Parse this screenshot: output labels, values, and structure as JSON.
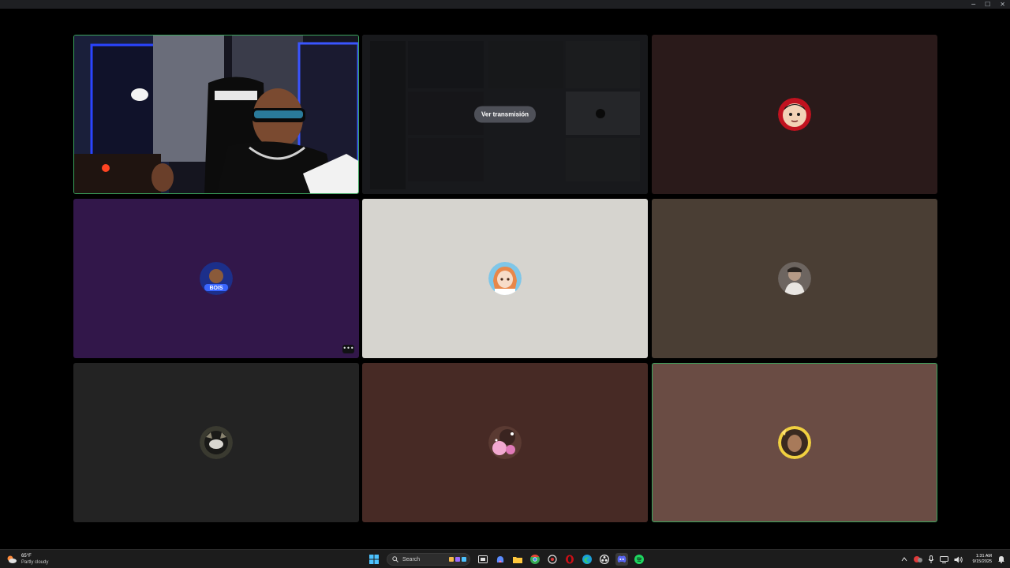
{
  "window": {
    "controls": [
      "minimize",
      "maximize",
      "close"
    ],
    "control_glyphs": {
      "minimize": "─",
      "maximize": "☐",
      "close": "✕"
    }
  },
  "colors": {
    "speaking_border": "#3ba55d",
    "tile_purple": "#32174a",
    "tile_light": "#d6d4cf",
    "tile_brown_olive": "#4a3e34",
    "tile_dark": "#232323",
    "tile_maroon": "#472a25",
    "tile_mauve": "#6a4c44",
    "tile_dark_red": "#2a1a1a"
  },
  "call_grid": {
    "tiles": [
      {
        "id": "webcam-user",
        "kind": "video",
        "speaking": true
      },
      {
        "id": "screen-share",
        "kind": "stream",
        "watch_label": "Ver transmisión"
      },
      {
        "id": "user-red-avatar",
        "kind": "avatar",
        "bg": "#2a1a1a"
      },
      {
        "id": "user-bois",
        "kind": "avatar",
        "bg": "#32174a",
        "avatar_text": "BOIS",
        "has_more_button": true
      },
      {
        "id": "user-anime-girl",
        "kind": "avatar",
        "bg": "#d6d4cf"
      },
      {
        "id": "user-photo",
        "kind": "avatar",
        "bg": "#4a3e34"
      },
      {
        "id": "user-dark-avatar",
        "kind": "avatar",
        "bg": "#232323"
      },
      {
        "id": "user-pink-avatar",
        "kind": "avatar",
        "bg": "#472a25"
      },
      {
        "id": "user-gold-avatar",
        "kind": "avatar",
        "bg": "#6a4c44",
        "speaking": true
      }
    ],
    "more_glyph": "•••"
  },
  "taskbar": {
    "weather": {
      "temp": "65°F",
      "condition": "Partly cloudy"
    },
    "search_label": "Search",
    "clock": {
      "time": "1:31 AM",
      "date": "9/15/2025"
    }
  }
}
